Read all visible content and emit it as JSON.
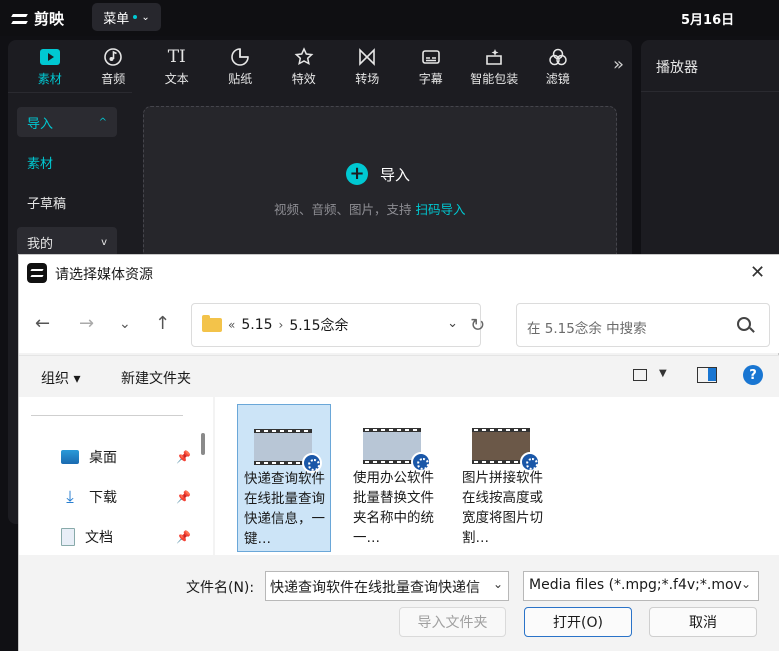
{
  "app": {
    "name": "剪映",
    "menu_label": "菜单",
    "date": "5月16日"
  },
  "toolbar": {
    "tools": [
      {
        "label": "素材",
        "icon": "media-icon",
        "active": true
      },
      {
        "label": "音频",
        "icon": "audio-icon"
      },
      {
        "label": "文本",
        "icon": "text-icon",
        "glyph": "TI"
      },
      {
        "label": "贴纸",
        "icon": "sticker-icon"
      },
      {
        "label": "特效",
        "icon": "effects-icon"
      },
      {
        "label": "转场",
        "icon": "transition-icon"
      },
      {
        "label": "字幕",
        "icon": "subtitle-icon"
      },
      {
        "label": "智能包装",
        "icon": "smart-pack-icon"
      },
      {
        "label": "滤镜",
        "icon": "filter-icon"
      }
    ],
    "more": "»"
  },
  "sidebar": {
    "items": [
      {
        "label": "导入",
        "chevron": "^"
      },
      {
        "label": "素材"
      },
      {
        "label": "子草稿"
      },
      {
        "label": "我的",
        "chevron": "v"
      }
    ]
  },
  "import_area": {
    "label": "导入",
    "hint_prefix": "视频、音频、图片，支持",
    "hint_link": "扫码导入"
  },
  "player": {
    "title": "播放器"
  },
  "dialog": {
    "title": "请选择媒体资源",
    "close": "✕",
    "breadcrumb": [
      "«",
      "5.15",
      "›",
      "5.15念余"
    ],
    "search_placeholder": "在 5.15念余 中搜索",
    "commands": {
      "organize": "组织 ▾",
      "new_folder": "新建文件夹"
    },
    "help": "?",
    "nav_items": [
      "桌面",
      "下载",
      "文档"
    ],
    "files": [
      {
        "name": "快递查询软件在线批量查询快递信息，一键…",
        "selected": true
      },
      {
        "name": "使用办公软件批量替换文件夹名称中的统一…",
        "selected": false
      },
      {
        "name": "图片拼接软件在线按高度或宽度将图片切割…",
        "selected": false
      }
    ],
    "filename_label": "文件名(N):",
    "filename_value": "快递查询软件在线批量查询快递信",
    "filetype_value": "Media files (*.mpg;*.f4v;*.mov",
    "buttons": {
      "import_folder": "导入文件夹",
      "open": "打开(O)",
      "cancel": "取消"
    }
  },
  "colors": {
    "accent": "#00c8d2",
    "dialog_blue": "#1976d2"
  }
}
